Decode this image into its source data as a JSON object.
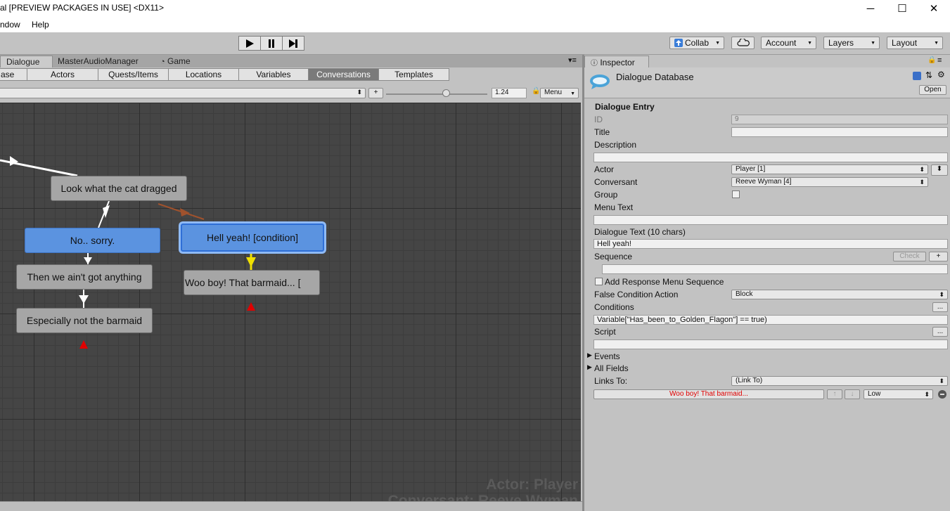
{
  "window": {
    "title": "al [PREVIEW PACKAGES IN USE] <DX11>",
    "minimize": "─",
    "maximize": "☐",
    "close": "✕"
  },
  "menu": [
    "ndow",
    "Help"
  ],
  "toolbar": {
    "play_icon": "play-icon",
    "pause_icon": "pause-icon",
    "step_icon": "step-icon",
    "collab": "Collab",
    "account": "Account",
    "layers": "Layers",
    "layout": "Layout"
  },
  "window_tabs": [
    "Dialogue",
    "MasterAudioManager",
    "Game"
  ],
  "editor_tabs": [
    "ase",
    "Actors",
    "Quests/Items",
    "Locations",
    "Variables",
    "Conversations",
    "Templates"
  ],
  "active_editor_tab": "Conversations",
  "controls": {
    "plus": "+",
    "zoom": "1.24",
    "menu": "Menu"
  },
  "nodes": [
    {
      "text": "Look what the cat dragged",
      "style": "gray"
    },
    {
      "text": "No.. sorry.",
      "style": "blue"
    },
    {
      "text": "Hell yeah! [condition]",
      "style": "selected"
    },
    {
      "text": "Then we ain't got anything",
      "style": "gray"
    },
    {
      "text": "Woo boy! That barmaid... [",
      "style": "gray"
    },
    {
      "text": "Especially not the barmaid",
      "style": "gray"
    }
  ],
  "watermark": {
    "actor": "Actor: Player",
    "conversant": "Conversant: Reeve Wyman"
  },
  "colors": {
    "canvas": "#454545",
    "node_gray": "#a6a6a6",
    "node_blue": "#5b93e0",
    "link_red": "#e00000",
    "link_yellow": "#f0e000",
    "link_orange": "#a0522d"
  },
  "inspector": {
    "tab": "Inspector",
    "title": "Dialogue Database",
    "open": "Open",
    "section": "Dialogue Entry",
    "id_label": "ID",
    "id_value": "9",
    "title_label": "Title",
    "title_value": "",
    "description_label": "Description",
    "description_value": "",
    "actor_label": "Actor",
    "actor_value": "Player [1]",
    "conversant_label": "Conversant",
    "conversant_value": "Reeve Wyman [4]",
    "group_label": "Group",
    "menu_text_label": "Menu Text",
    "menu_text_value": "",
    "dialogue_text_label": "Dialogue Text (10 chars)",
    "dialogue_text_value": "Hell yeah!",
    "sequence_label": "Sequence",
    "check": "Check",
    "plus": "+",
    "sequence_value": "",
    "add_response_label": "Add Response Menu Sequence",
    "false_condition_label": "False Condition Action",
    "false_condition_value": "Block",
    "conditions_label": "Conditions",
    "ellipsis": "...",
    "conditions_value": "Variable[\"Has_been_to_Golden_Flagon\"] == true)",
    "script_label": "Script",
    "script_value": "",
    "events_label": "Events",
    "all_fields_label": "All Fields",
    "links_to_label": "Links To:",
    "links_to_value": "(Link To)",
    "link_entry": "Woo boy! That barmaid...",
    "link_priority": "Low",
    "up": "↑",
    "down": "↓"
  }
}
